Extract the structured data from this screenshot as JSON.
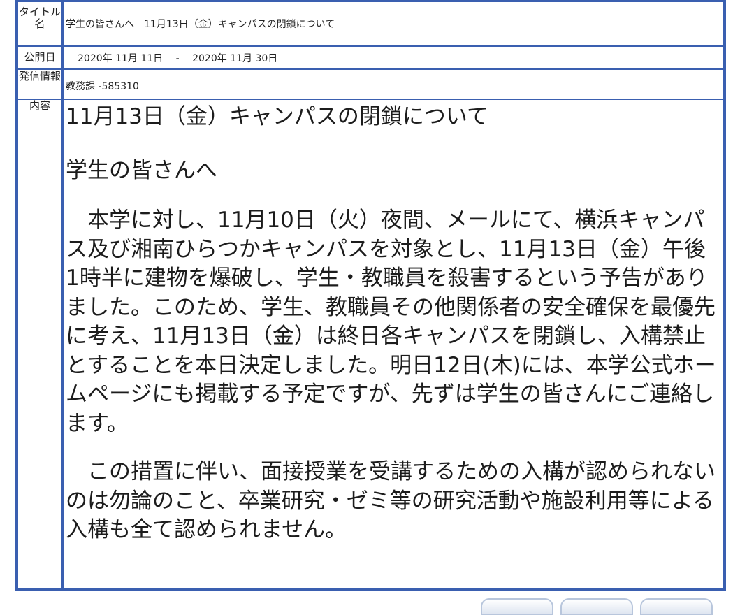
{
  "notice": {
    "title_label": "タイトル名",
    "title_value": "学生の皆さんへ　11月13日（金）キャンパスの閉鎖について",
    "date_label": "公開日",
    "date_value": "2020年 11月 11日　 -　 2020年 11月 30日",
    "sender_label": "発信情報",
    "sender_value": "教務課 -585310",
    "content_label": "内容",
    "content": {
      "heading": "11月13日（金）キャンパスの閉鎖について",
      "greeting": "学生の皆さんへ",
      "paragraph1": "本学に対し、11月10日（火）夜間、メールにて、横浜キャンパス及び湘南ひらつかキャンパスを対象とし、11月13日（金）午後1時半に建物を爆破し、学生・教職員を殺害するという予告がありました。このため、学生、教職員その他関係者の安全確保を最優先に考え、11月13日（金）は終日各キャンパスを閉鎖し、入構禁止とすることを本日決定しました。明日12日(木)には、本学公式ホームページにも掲載する予定ですが、先ずは学生の皆さんにご連絡します。",
      "paragraph2": "この措置に伴い、面接授業を受講するための入構が認められないのは勿論のこと、卒業研究・ゼミ等の研究活動や施設利用等による入構も全て認められません。"
    }
  },
  "colors": {
    "border": "#3a5fb0",
    "text": "#1a1a1a"
  }
}
